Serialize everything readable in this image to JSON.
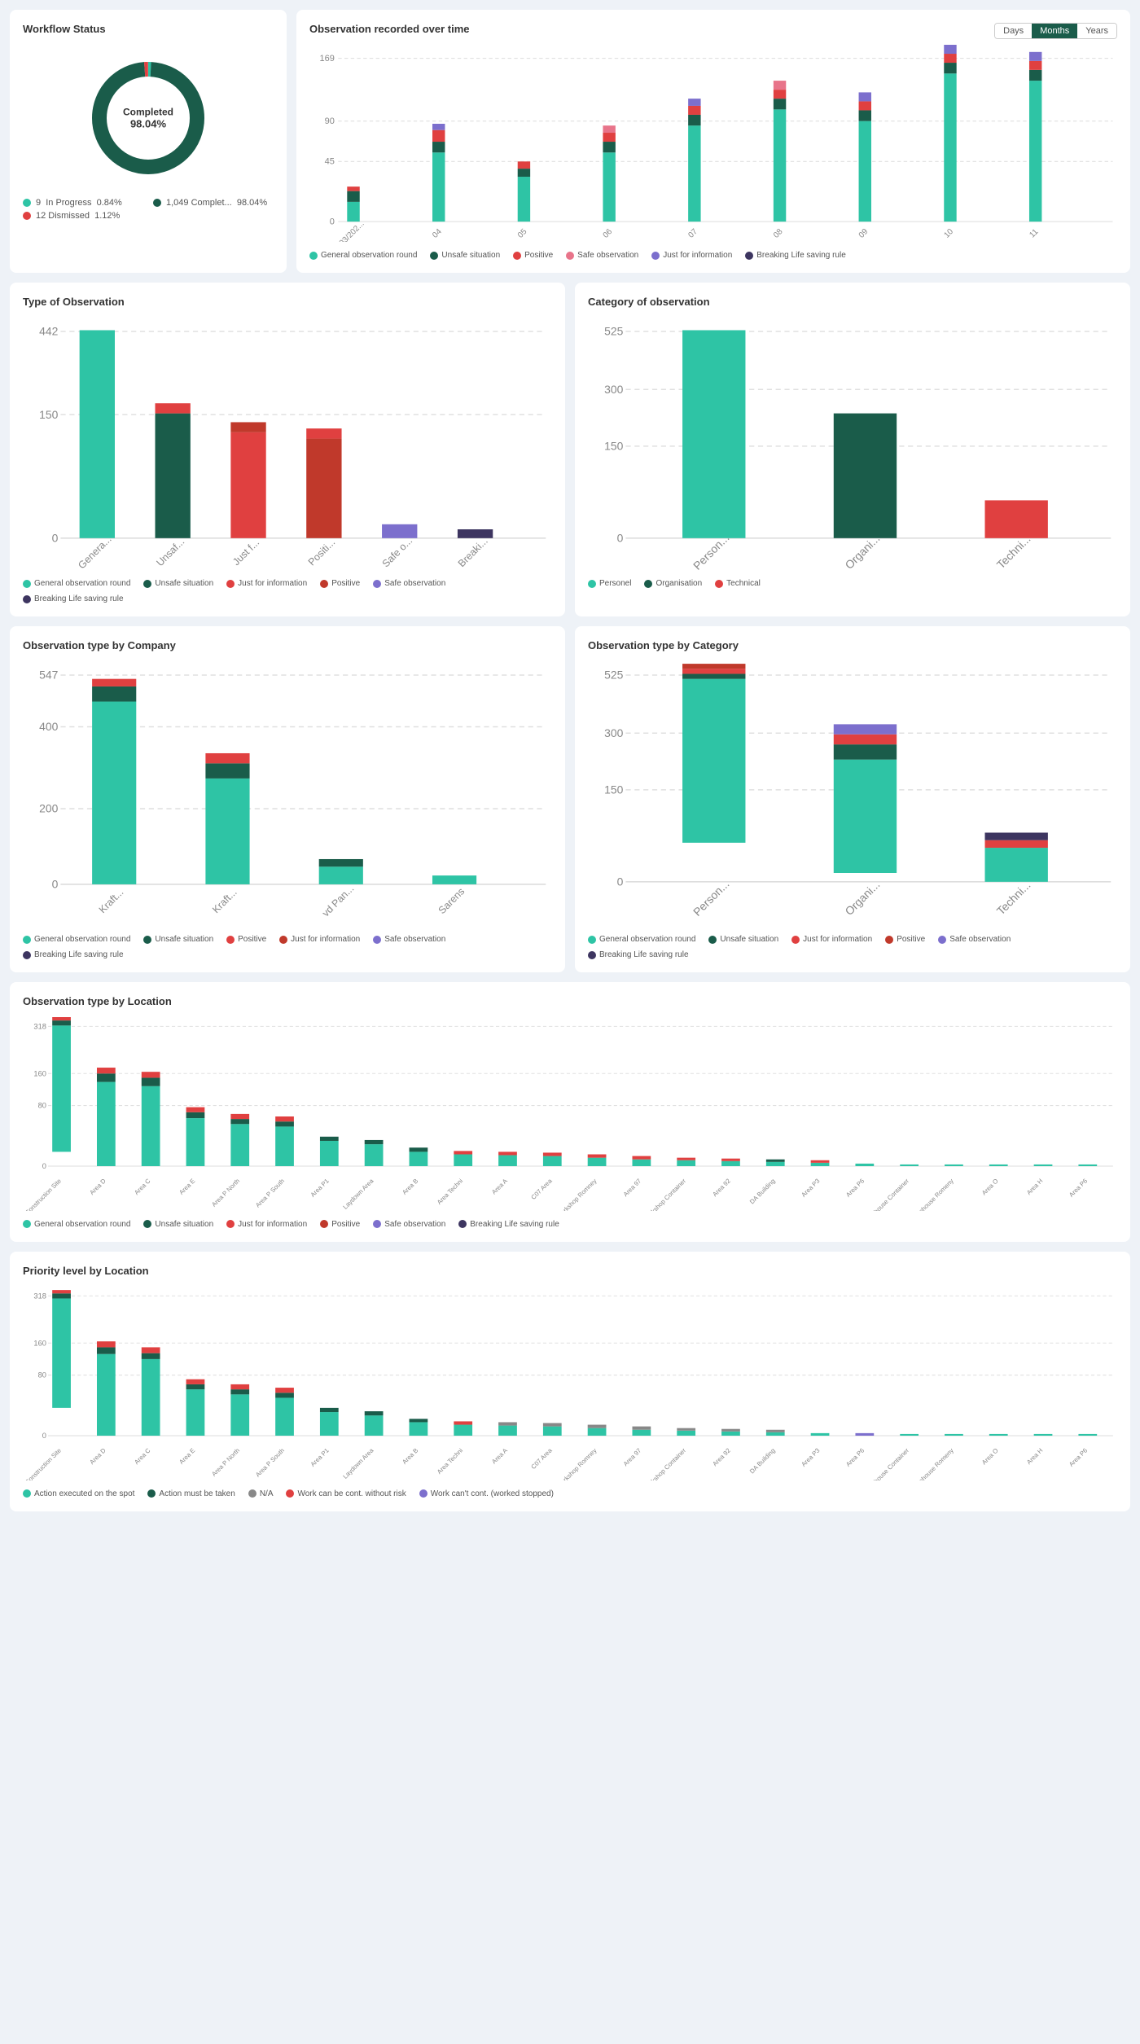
{
  "colors": {
    "green_light": "#2ec4a5",
    "green_dark": "#1a5c4a",
    "red": "#e04040",
    "blue_purple": "#7c6fcd",
    "dark_purple": "#3d3560",
    "pink": "#e8748a",
    "teal": "#2ec4a5",
    "bg": "#eef2f7"
  },
  "workflow": {
    "title": "Workflow Status",
    "completed_label": "Completed",
    "completed_pct": "98.04%",
    "legend": [
      {
        "color": "#2ec4a5",
        "count": "9",
        "label": "In Progress",
        "pct": "0.84%"
      },
      {
        "color": "#1a5c4a",
        "count": "1,049",
        "label": "Complet...",
        "pct": "98.04%"
      },
      {
        "color": "#e04040",
        "count": "12",
        "label": "Dismissed",
        "pct": "1.12%"
      }
    ]
  },
  "observation_time": {
    "title": "Observation recorded over time",
    "buttons": [
      "Days",
      "Months",
      "Years"
    ],
    "active_button": "Months",
    "y_max": 169,
    "y_labels": [
      "169",
      "90",
      "45",
      "0"
    ],
    "x_labels": [
      "03/202...",
      "04",
      "05",
      "06",
      "07",
      "08",
      "09",
      "10",
      "11"
    ],
    "legend": [
      {
        "color": "#2ec4a5",
        "label": "General observation round"
      },
      {
        "color": "#1a5c4a",
        "label": "Unsafe situation"
      },
      {
        "color": "#e04040",
        "label": "Positive"
      },
      {
        "color": "#e8748a",
        "label": "Safe observation"
      },
      {
        "color": "#7c6fcd",
        "label": "Just for information"
      },
      {
        "color": "#3d3560",
        "label": "Breaking Life saving rule"
      }
    ]
  },
  "type_observation": {
    "title": "Type of Observation",
    "y_max": 442,
    "y_labels": [
      "442",
      "150",
      "0"
    ],
    "x_labels": [
      "Genera...",
      "Unsaf...",
      "Just f...",
      "Positi...",
      "Safe o...",
      "Breaki..."
    ],
    "legend": [
      {
        "color": "#2ec4a5",
        "label": "General observation round"
      },
      {
        "color": "#1a5c4a",
        "label": "Unsafe situation"
      },
      {
        "color": "#e04040",
        "label": "Just for information"
      },
      {
        "color": "#c0392b",
        "label": "Positive"
      },
      {
        "color": "#7c6fcd",
        "label": "Safe observation"
      },
      {
        "color": "#3d3560",
        "label": "Breaking Life saving rule"
      }
    ]
  },
  "category_observation": {
    "title": "Category of observation",
    "y_max": 525,
    "y_labels": [
      "525",
      "300",
      "150",
      "0"
    ],
    "x_labels": [
      "Person...",
      "Organi...",
      "Techni..."
    ],
    "legend": [
      {
        "color": "#2ec4a5",
        "label": "Personel"
      },
      {
        "color": "#1a5c4a",
        "label": "Organisation"
      },
      {
        "color": "#e04040",
        "label": "Technical"
      }
    ]
  },
  "obs_type_company": {
    "title": "Observation type by Company",
    "y_max": 547,
    "y_labels": [
      "547",
      "400",
      "200",
      "0"
    ],
    "x_labels": [
      "Kraft...",
      "Kraft...",
      "vd Pan...",
      "Sarens"
    ],
    "legend": [
      {
        "color": "#2ec4a5",
        "label": "General observation round"
      },
      {
        "color": "#1a5c4a",
        "label": "Unsafe situation"
      },
      {
        "color": "#e04040",
        "label": "Positive"
      },
      {
        "color": "#c0392b",
        "label": "Just for information"
      },
      {
        "color": "#7c6fcd",
        "label": "Safe observation"
      },
      {
        "color": "#3d3560",
        "label": "Breaking Life saving rule"
      }
    ]
  },
  "obs_type_category": {
    "title": "Observation type by Category",
    "y_max": 525,
    "y_labels": [
      "525",
      "300",
      "150",
      "0"
    ],
    "x_labels": [
      "Person...",
      "Organi...",
      "Techni..."
    ],
    "legend": [
      {
        "color": "#2ec4a5",
        "label": "General observation round"
      },
      {
        "color": "#1a5c4a",
        "label": "Unsafe situation"
      },
      {
        "color": "#e04040",
        "label": "Just for information"
      },
      {
        "color": "#c0392b",
        "label": "Positive"
      },
      {
        "color": "#7c6fcd",
        "label": "Safe observation"
      },
      {
        "color": "#3d3560",
        "label": "Breaking Life saving rule"
      }
    ]
  },
  "obs_type_location": {
    "title": "Observation type by Location",
    "y_max": 318,
    "y_labels": [
      "318",
      "160",
      "80",
      "0"
    ],
    "x_labels": [
      "Construction Site",
      "Area D",
      "Area C",
      "Area E",
      "Area P North",
      "Area P South",
      "Area P1",
      "Laydown Area",
      "Area B",
      "Area Techni",
      "Area A",
      "C07 Area",
      "Workshop Romney",
      "Area 97",
      "Workshop Container",
      "Area 92",
      "DA Building",
      "Area P3",
      "Area P6",
      "Warehouse Container",
      "Warehouse Romeny",
      "Area O",
      "Area H",
      "Area P6"
    ],
    "legend": [
      {
        "color": "#2ec4a5",
        "label": "General observation round"
      },
      {
        "color": "#1a5c4a",
        "label": "Unsafe situation"
      },
      {
        "color": "#e04040",
        "label": "Just for information"
      },
      {
        "color": "#c0392b",
        "label": "Positive"
      },
      {
        "color": "#7c6fcd",
        "label": "Safe observation"
      },
      {
        "color": "#3d3560",
        "label": "Breaking Life saving rule"
      }
    ]
  },
  "priority_location": {
    "title": "Priority level by Location",
    "y_max": 318,
    "y_labels": [
      "318",
      "160",
      "80",
      "0"
    ],
    "x_labels": [
      "Construction Site",
      "Area D",
      "Area C",
      "Area E",
      "Area P North",
      "Area P South",
      "Area P1",
      "Laydown Area",
      "Area B",
      "Area Techni",
      "Area A",
      "C07 Area",
      "Workshop Romney",
      "Area 97",
      "Workshop Container",
      "Area 92",
      "DA Building",
      "Area P3",
      "Area P6",
      "Warehouse Container",
      "Warehouse Romeny",
      "Area O",
      "Area H",
      "Area P6"
    ],
    "legend": [
      {
        "color": "#2ec4a5",
        "label": "Action executed on the spot"
      },
      {
        "color": "#1a5c4a",
        "label": "Action must be taken"
      },
      {
        "color": "#888",
        "label": "N/A"
      },
      {
        "color": "#e04040",
        "label": "Work can be cont. without risk"
      },
      {
        "color": "#7c6fcd",
        "label": "Work can't cont. (worked stopped)"
      }
    ]
  }
}
